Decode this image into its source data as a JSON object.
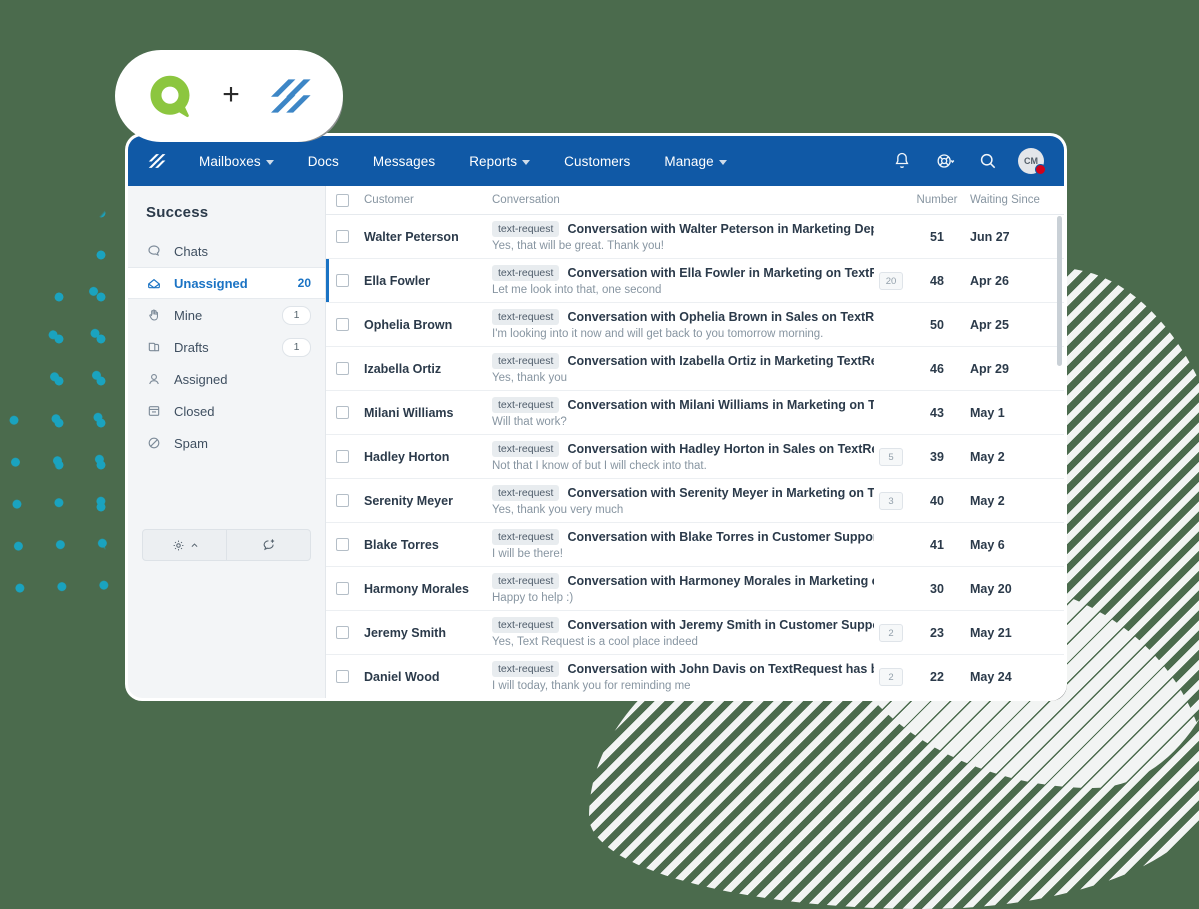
{
  "brand": {
    "badge_alt": "Qualtrics plus Help Scout",
    "plus_symbol": "+",
    "green": "#8cc63f",
    "blue": "#3d86c6",
    "navbar_color": "#1059a6",
    "accent_color": "#1a73c4",
    "background_color": "#4b6b4d",
    "dot_color": "#1aa3bf"
  },
  "topnav": {
    "logo_name": "helpscout-logo-icon",
    "items": [
      {
        "label": "Mailboxes",
        "has_caret": true
      },
      {
        "label": "Docs",
        "has_caret": false
      },
      {
        "label": "Messages",
        "has_caret": false
      },
      {
        "label": "Reports",
        "has_caret": true
      },
      {
        "label": "Customers",
        "has_caret": false
      },
      {
        "label": "Manage",
        "has_caret": true
      }
    ],
    "right_icons": [
      "bell-icon",
      "lifebuoy-icon",
      "search-icon"
    ],
    "avatar_initials": "CM",
    "avatar_has_notification": true
  },
  "sidebar": {
    "title": "Success",
    "items": [
      {
        "label": "Chats",
        "icon": "chat-bubble-icon",
        "count": "",
        "count_style": "none",
        "active": false
      },
      {
        "label": "Unassigned",
        "icon": "inbox-open-icon",
        "count": "20",
        "count_style": "plain",
        "active": true
      },
      {
        "label": "Mine",
        "icon": "hand-icon",
        "count": "1",
        "count_style": "pill",
        "active": false
      },
      {
        "label": "Drafts",
        "icon": "drafts-icon",
        "count": "1",
        "count_style": "pill",
        "active": false
      },
      {
        "label": "Assigned",
        "icon": "user-icon",
        "count": "",
        "count_style": "none",
        "active": false
      },
      {
        "label": "Closed",
        "icon": "archive-icon",
        "count": "",
        "count_style": "none",
        "active": false
      },
      {
        "label": "Spam",
        "icon": "ban-icon",
        "count": "",
        "count_style": "none",
        "active": false
      }
    ],
    "footer_buttons": [
      {
        "name": "settings-button",
        "icon": "gear-icon",
        "caret": "chevron-up-icon"
      },
      {
        "name": "new-conversation-button",
        "icon": "new-chat-plus-icon",
        "caret": ""
      }
    ]
  },
  "table": {
    "headers": {
      "customer": "Customer",
      "conversation": "Conversation",
      "number": "Number",
      "waiting_since": "Waiting Since"
    },
    "rows": [
      {
        "customer": "Walter Peterson",
        "tag": "text-request",
        "title": "Conversation with Walter Peterson in Marketing Department on TextRequest",
        "preview": "Yes, that will be great. Thank you!",
        "msg_count": "",
        "number": "51",
        "waiting_since": "Jun 27",
        "selected": false
      },
      {
        "customer": "Ella Fowler",
        "tag": "text-request",
        "title": "Conversation with Ella Fowler in Marketing on TextRequest has been updated",
        "preview": "Let me look into that, one second",
        "msg_count": "20",
        "number": "48",
        "waiting_since": "Apr 26",
        "selected": true
      },
      {
        "customer": "Ophelia Brown",
        "tag": "text-request",
        "title": "Conversation with Ophelia Brown in Sales on TextRequest has been updated",
        "preview": "I'm looking into it now and will get back to you tomorrow morning.",
        "msg_count": "",
        "number": "50",
        "waiting_since": "Apr 25",
        "selected": false
      },
      {
        "customer": "Izabella Ortiz",
        "tag": "text-request",
        "title": "Conversation with Izabella Ortiz in Marketing TextRequest has been updated",
        "preview": "Yes, thank you",
        "msg_count": "",
        "number": "46",
        "waiting_since": "Apr 29",
        "selected": false
      },
      {
        "customer": "Milani Williams",
        "tag": "text-request",
        "title": "Conversation with Milani Williams in Marketing on TextRequest has been updated",
        "preview": "Will that work?",
        "msg_count": "",
        "number": "43",
        "waiting_since": "May 1",
        "selected": false
      },
      {
        "customer": "Hadley Horton",
        "tag": "text-request",
        "title": "Conversation with Hadley Horton in Sales on TextRequest has been updated",
        "preview": "Not that I know of but I will check into that.",
        "msg_count": "5",
        "number": "39",
        "waiting_since": "May 2",
        "selected": false
      },
      {
        "customer": "Serenity Meyer",
        "tag": "text-request",
        "title": "Conversation with Serenity Meyer in Marketing on TextRequest has been updated",
        "preview": "Yes, thank you very much",
        "msg_count": "3",
        "number": "40",
        "waiting_since": "May 2",
        "selected": false
      },
      {
        "customer": "Blake Torres",
        "tag": "text-request",
        "title": "Conversation with Blake Torres in Customer Support on TextRequest has been updated",
        "preview": "I will be there!",
        "msg_count": "",
        "number": "41",
        "waiting_since": "May 6",
        "selected": false
      },
      {
        "customer": "Harmony Morales",
        "tag": "text-request",
        "title": "Conversation with Harmoney Morales in Marketing on TextRequest has been updated",
        "preview": "Happy to help :)",
        "msg_count": "",
        "number": "30",
        "waiting_since": "May 20",
        "selected": false
      },
      {
        "customer": "Jeremy Smith",
        "tag": "text-request",
        "title": "Conversation with Jeremy Smith in Customer Support on TextRequest has been updated",
        "preview": "Yes, Text Request is a cool place indeed",
        "msg_count": "2",
        "number": "23",
        "waiting_since": "May 21",
        "selected": false
      },
      {
        "customer": "Daniel Wood",
        "tag": "text-request",
        "title": "Conversation with John Davis on TextRequest has been updated",
        "preview": "I will today, thank you for reminding me",
        "msg_count": "2",
        "number": "22",
        "waiting_since": "May 24",
        "selected": false
      }
    ]
  }
}
